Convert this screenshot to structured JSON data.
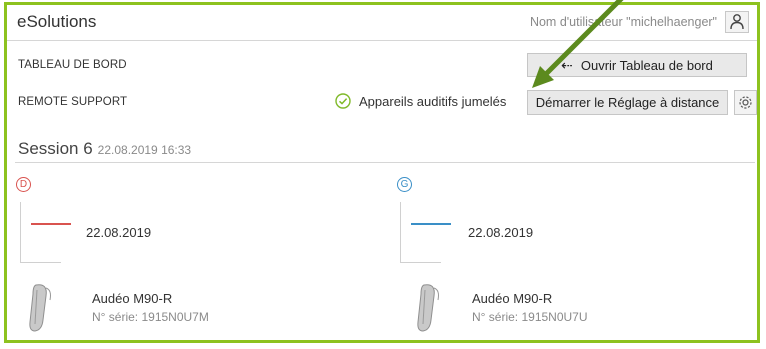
{
  "app": {
    "title": "eSolutions"
  },
  "user": {
    "label": "Nom d'utilisateur \"michelhaenger\"",
    "icon": "person-icon"
  },
  "dashboard": {
    "label": "TABLEAU DE BORD",
    "open_button": "Ouvrir Tableau de bord",
    "open_icon": "enter-icon"
  },
  "remote": {
    "label": "REMOTE SUPPORT",
    "status": "Appareils auditifs jumelés",
    "status_icon": "check-circle-icon",
    "start_button": "Démarrer le Réglage à distance",
    "settings_icon": "gear-icon"
  },
  "session": {
    "title": "Session 6",
    "datetime": "22.08.2019 16:33"
  },
  "devices": [
    {
      "side": "D",
      "color": "#d9534f",
      "date": "22.08.2019",
      "model": "Audéo M90-R",
      "serial": "N° série: 1915N0U7M"
    },
    {
      "side": "G",
      "color": "#3a8fc7",
      "date": "22.08.2019",
      "model": "Audéo M90-R",
      "serial": "N° série: 1915N0U7U"
    }
  ],
  "colors": {
    "frame": "#8dc21f",
    "arrow": "#5c8a1e",
    "right": "#d9534f",
    "left": "#3a8fc7"
  }
}
